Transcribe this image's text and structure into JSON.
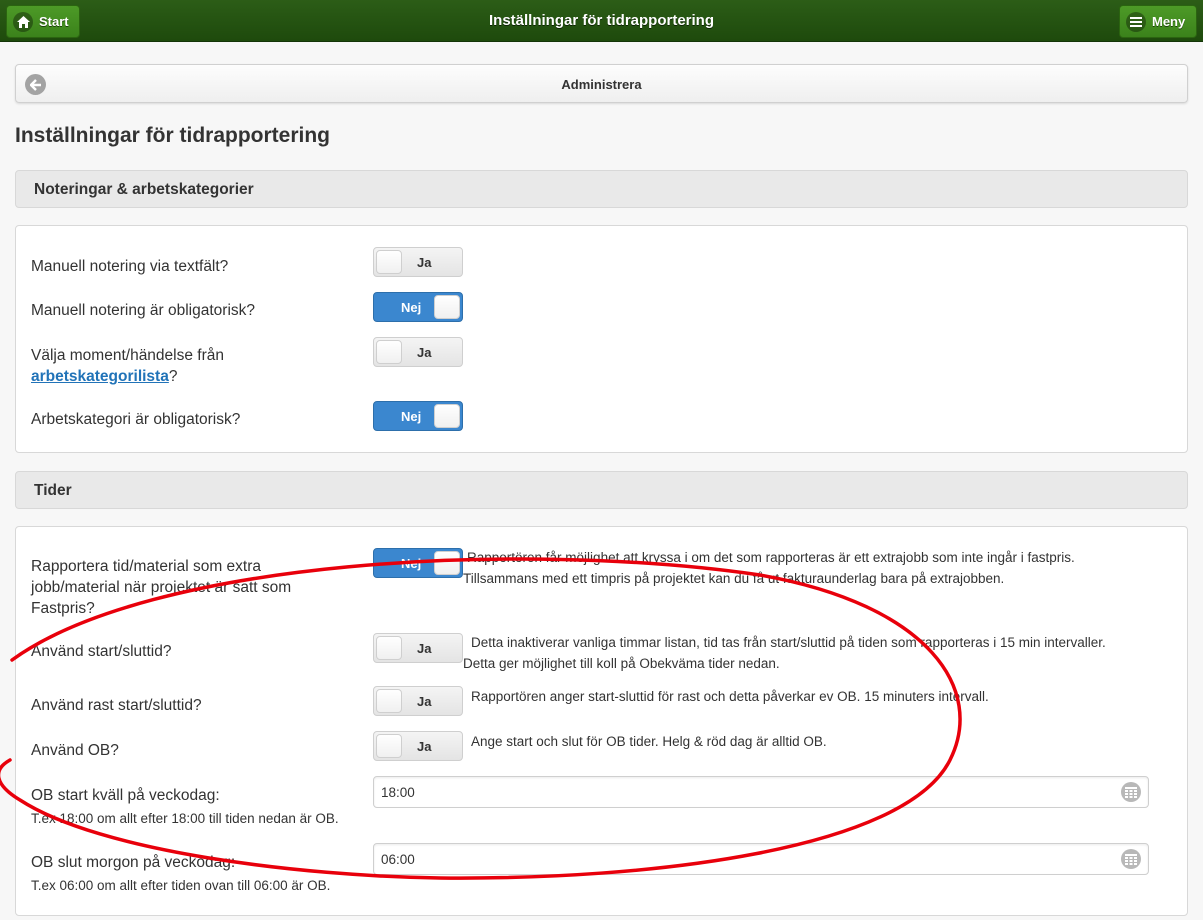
{
  "header": {
    "start_label": "Start",
    "title": "Inställningar för tidrapportering",
    "menu_label": "Meny"
  },
  "adminbar": {
    "label": "Administrera"
  },
  "page_title": "Inställningar för tidrapportering",
  "section1": {
    "title": "Noteringar & arbetskategorier",
    "rows": [
      {
        "label": "Manuell notering via textfält?",
        "toggle": "Ja",
        "on": false
      },
      {
        "label": "Manuell notering är obligatorisk?",
        "toggle": "Nej",
        "on": true
      },
      {
        "label_pre": "Välja moment/händelse från",
        "label_link": "arbetskategorilista",
        "label_post": "?",
        "toggle": "Ja",
        "on": false
      },
      {
        "label": "Arbetskategori är obligatorisk?",
        "toggle": "Nej",
        "on": true
      }
    ]
  },
  "section2": {
    "title": "Tider",
    "rows": [
      {
        "label_l1": "Rapportera tid/material som extra",
        "label_l2": "jobb/material när projektet är satt som",
        "label_l3": "Fastpris?",
        "toggle": "Nej",
        "on": true,
        "desc_l1": "Rapportören får möjlighet att kryssa i om det som rapporteras är ett extrajobb som inte ingår i fastpris.",
        "desc_l2": "Tillsammans med ett timpris på projektet kan du få ut fakturaunderlag bara på extrajobben."
      },
      {
        "label": "Använd start/sluttid?",
        "toggle": "Ja",
        "on": false,
        "desc_l1": "Detta inaktiverar vanliga timmar listan, tid tas från start/sluttid på tiden som rapporteras i 15 min intervaller.",
        "desc_l2": "Detta ger möjlighet till koll på Obekväma tider nedan."
      },
      {
        "label": "Använd rast start/sluttid?",
        "toggle": "Ja",
        "on": false,
        "desc_l1": "Rapportören anger start-sluttid för rast och detta påverkar ev OB. 15 minuters intervall."
      },
      {
        "label": "Använd OB?",
        "toggle": "Ja",
        "on": false,
        "desc_l1": "Ange start och slut för OB tider. Helg & röd dag är alltid OB."
      },
      {
        "label": "OB start kväll på veckodag:",
        "sublabel": "T.ex 18:00 om allt efter 18:00 till tiden nedan är OB.",
        "value": "18:00"
      },
      {
        "label": "OB slut morgon på veckodag:",
        "sublabel": "T.ex 06:00 om allt efter tiden ovan till 06:00 är OB.",
        "value": "06:00"
      }
    ]
  },
  "colors": {
    "header_green": "#2c5d17",
    "button_green": "#4d9a27",
    "toggle_on": "#3b87cf",
    "link": "#2173b8",
    "annotation": "#e8000b"
  },
  "icons": {
    "home": "home-icon",
    "menu": "hamburger-icon",
    "back": "back-arrow-icon",
    "calendar": "calendar-icon"
  }
}
